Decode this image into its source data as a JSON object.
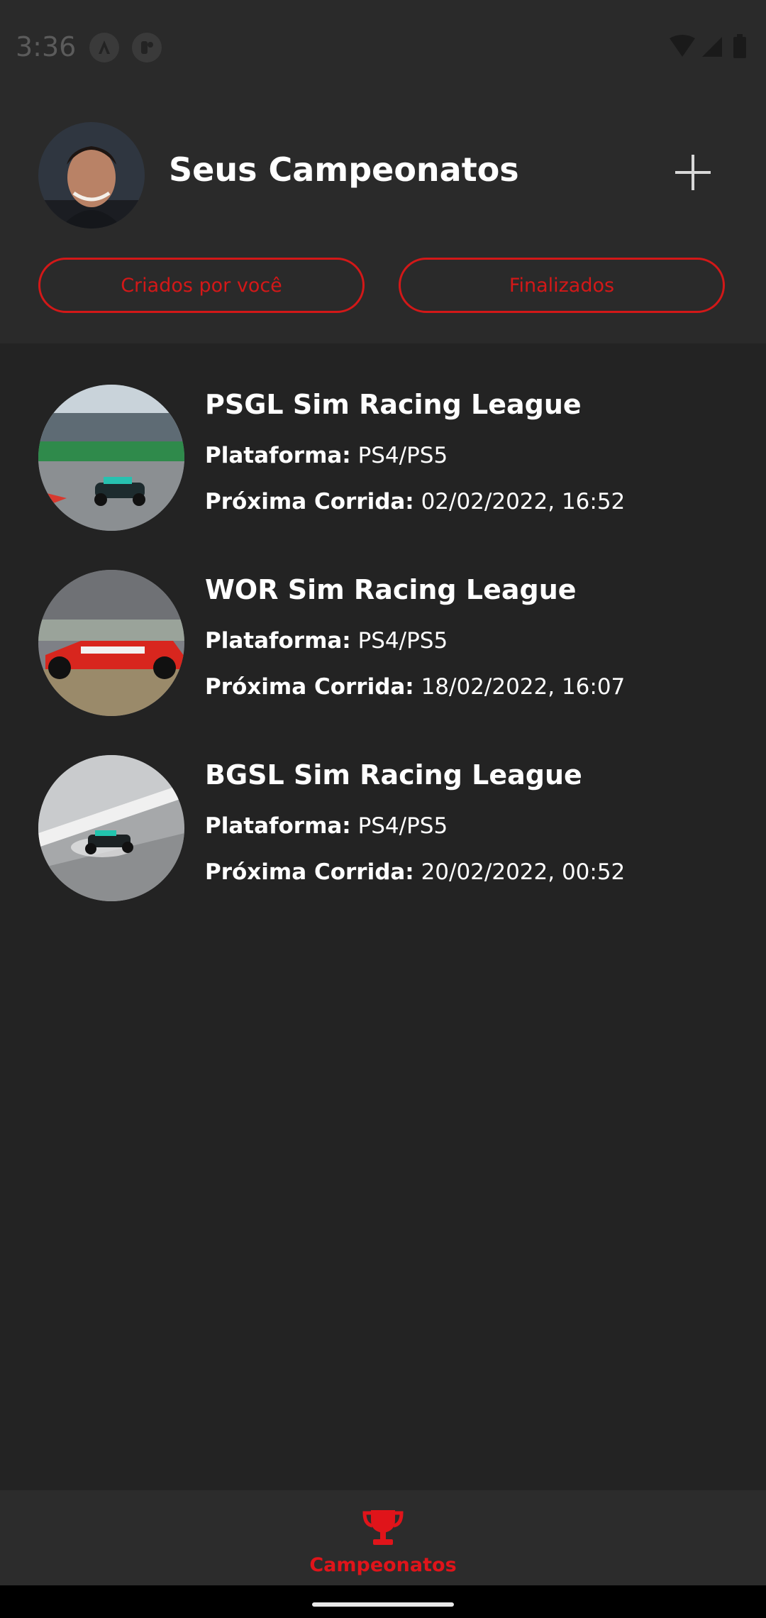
{
  "status_bar": {
    "time": "3:36"
  },
  "header": {
    "title": "Seus Campeonatos",
    "add_icon": "plus-icon",
    "filters": [
      {
        "label": "Criados por você"
      },
      {
        "label": "Finalizados"
      }
    ]
  },
  "championships": [
    {
      "name": "PSGL Sim Racing League",
      "platform_label": "Plataforma:",
      "platform": "PS4/PS5",
      "next_race_label": "Próxima Corrida:",
      "next_race": "02/02/2022, 16:52"
    },
    {
      "name": "WOR Sim Racing League",
      "platform_label": "Plataforma:",
      "platform": "PS4/PS5",
      "next_race_label": "Próxima Corrida:",
      "next_race": "18/02/2022, 16:07"
    },
    {
      "name": "BGSL Sim Racing League",
      "platform_label": "Plataforma:",
      "platform": "PS4/PS5",
      "next_race_label": "Próxima Corrida:",
      "next_race": "20/02/2022, 00:52"
    }
  ],
  "bottom_nav": {
    "items": [
      {
        "label": "Campeonatos",
        "icon": "trophy-icon",
        "active": true
      }
    ]
  },
  "colors": {
    "accent": "#e0141a",
    "background": "#232323",
    "header_background": "#2a2a2a"
  }
}
